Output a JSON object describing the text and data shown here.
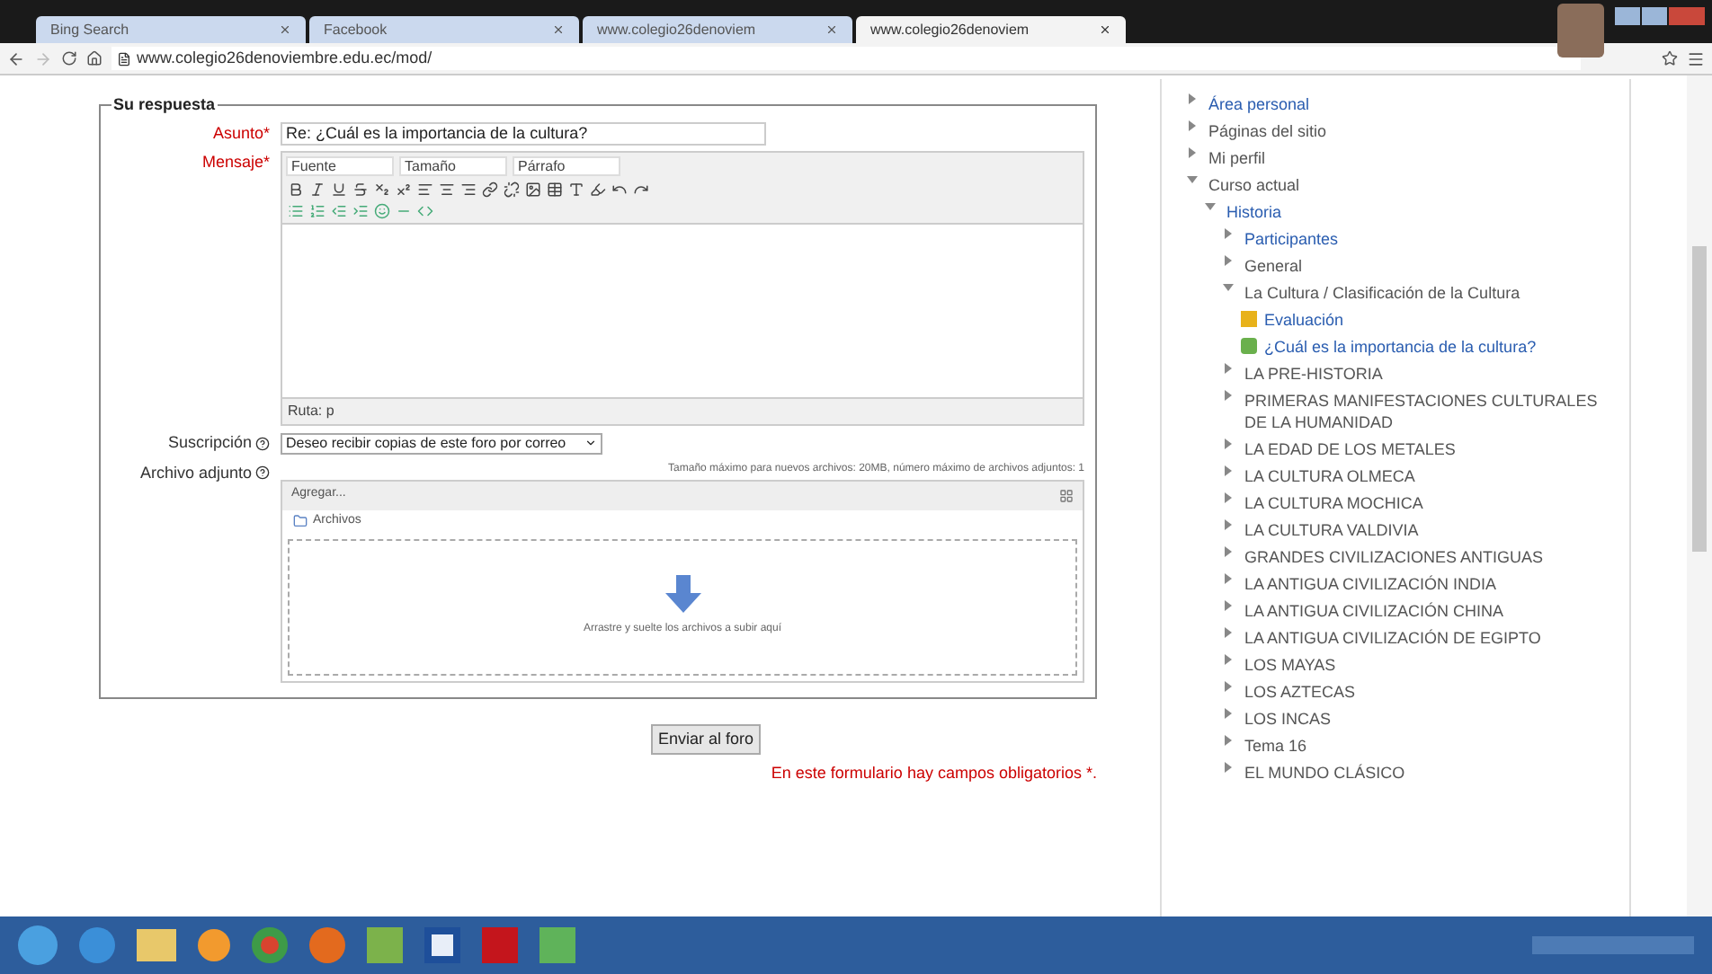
{
  "browser": {
    "tabs": [
      {
        "label": "Bing Search",
        "selected": false
      },
      {
        "label": "Facebook",
        "selected": false
      },
      {
        "label": "www.colegio26denoviem",
        "selected": false
      },
      {
        "label": "www.colegio26denoviem",
        "selected": true
      }
    ],
    "url": "www.colegio26denoviembre.edu.ec/mod/"
  },
  "form": {
    "legend": "Su respuesta",
    "subject": {
      "label": "Asunto",
      "required_mark": "*",
      "value": "Re: ¿Cuál es la importancia de la cultura?"
    },
    "message": {
      "label": "Mensaje",
      "required_mark": "*",
      "dropdowns": [
        "Fuente",
        "Tamaño",
        "Párrafo"
      ],
      "path": "Ruta: p"
    },
    "subscription": {
      "label": "Suscripción",
      "value": "Deseo recibir copias de este foro por correo"
    },
    "attachment": {
      "label": "Archivo adjunto",
      "limits": "Tamaño máximo para nuevos archivos: 20MB, número máximo de archivos adjuntos: 1",
      "add": "Agregar...",
      "folder": "Archivos",
      "drop_hint": "Arrastre y suelte los archivos a subir aquí"
    },
    "submit": "Enviar al foro",
    "required_note": "En este formulario hay campos obligatorios *."
  },
  "navigation": [
    {
      "label": "Área personal",
      "kind": "branch",
      "link": true,
      "expanded": false
    },
    {
      "label": "Páginas del sitio",
      "kind": "branch",
      "link": false,
      "expanded": false
    },
    {
      "label": "Mi perfil",
      "kind": "branch",
      "link": false,
      "expanded": false
    },
    {
      "label": "Curso actual",
      "kind": "branch",
      "link": false,
      "expanded": true,
      "children": [
        {
          "label": "Historia",
          "kind": "branch",
          "link": true,
          "expanded": true,
          "children": [
            {
              "label": "Participantes",
              "kind": "branch",
              "link": true,
              "expanded": false
            },
            {
              "label": "General",
              "kind": "branch",
              "link": false,
              "expanded": false
            },
            {
              "label": "La Cultura / Clasificación de la Cultura",
              "kind": "branch",
              "link": false,
              "expanded": true,
              "children": [
                {
                  "label": "Evaluación",
                  "kind": "quiz",
                  "link": true
                },
                {
                  "label": "¿Cuál es la importancia de la cultura?",
                  "kind": "forum",
                  "link": true
                }
              ]
            },
            {
              "label": "LA PRE-HISTORIA",
              "kind": "branch",
              "link": false,
              "expanded": false
            },
            {
              "label": "PRIMERAS MANIFESTACIONES CULTURALES DE LA HUMANIDAD",
              "kind": "branch",
              "link": false,
              "expanded": false
            },
            {
              "label": "LA EDAD DE LOS METALES",
              "kind": "branch",
              "link": false,
              "expanded": false
            },
            {
              "label": "LA CULTURA OLMECA",
              "kind": "branch",
              "link": false,
              "expanded": false
            },
            {
              "label": "LA CULTURA MOCHICA",
              "kind": "branch",
              "link": false,
              "expanded": false
            },
            {
              "label": "LA CULTURA VALDIVIA",
              "kind": "branch",
              "link": false,
              "expanded": false
            },
            {
              "label": "GRANDES CIVILIZACIONES ANTIGUAS",
              "kind": "branch",
              "link": false,
              "expanded": false
            },
            {
              "label": "LA ANTIGUA CIVILIZACIÓN INDIA",
              "kind": "branch",
              "link": false,
              "expanded": false
            },
            {
              "label": "LA ANTIGUA CIVILIZACIÓN CHINA",
              "kind": "branch",
              "link": false,
              "expanded": false
            },
            {
              "label": "LA ANTIGUA CIVILIZACIÓN DE EGIPTO",
              "kind": "branch",
              "link": false,
              "expanded": false
            },
            {
              "label": "LOS MAYAS",
              "kind": "branch",
              "link": false,
              "expanded": false
            },
            {
              "label": "LOS AZTECAS",
              "kind": "branch",
              "link": false,
              "expanded": false
            },
            {
              "label": "LOS INCAS",
              "kind": "branch",
              "link": false,
              "expanded": false
            },
            {
              "label": "Tema 16",
              "kind": "branch",
              "link": false,
              "expanded": false
            },
            {
              "label": "EL MUNDO CLÁSICO",
              "kind": "branch",
              "link": false,
              "expanded": false
            }
          ]
        }
      ]
    }
  ]
}
